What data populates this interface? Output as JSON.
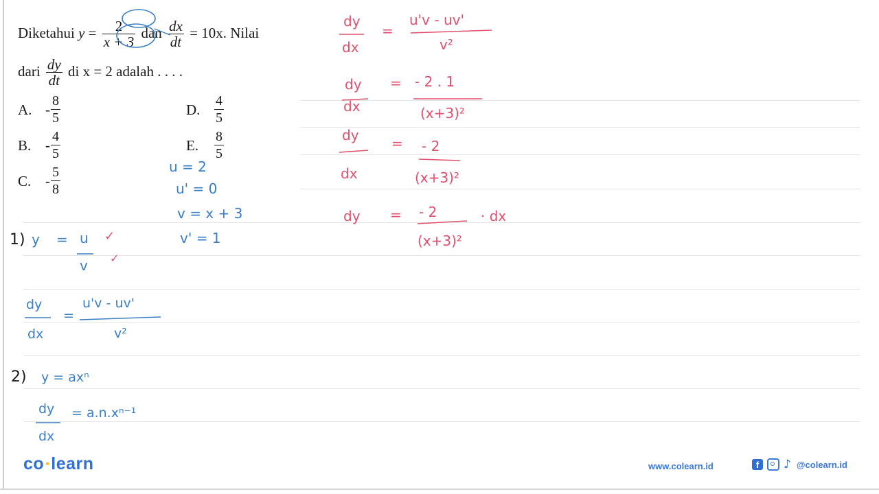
{
  "question": {
    "intro": "Diketahui",
    "y_var": "y",
    "equals": "=",
    "frac1_num": "2",
    "frac1_den": "x + 3",
    "conj": "dan",
    "frac2_num": "dx",
    "frac2_den": "dt",
    "rhs": "= 10x. Nilai",
    "line2_prefix": "dari",
    "frac3_num": "dy",
    "frac3_den": "dt",
    "line2_suffix": "di x = 2 adalah . . . ."
  },
  "options": [
    {
      "letter": "A.",
      "sign": "-",
      "num": "8",
      "den": "5"
    },
    {
      "letter": "B.",
      "sign": "-",
      "num": "4",
      "den": "5"
    },
    {
      "letter": "C.",
      "sign": "-",
      "num": "5",
      "den": "8"
    },
    {
      "letter": "D.",
      "sign": "",
      "num": "4",
      "den": "5"
    },
    {
      "letter": "E.",
      "sign": "",
      "num": "8",
      "den": "5"
    }
  ],
  "handwriting": {
    "blue_defs": [
      "u = 2",
      "u' = 0",
      "v = x + 3",
      "v' = 1"
    ],
    "step1_label": "1)",
    "step1_lhs": "y",
    "step1_eq": "=",
    "step1_num": "u",
    "step1_den": "v",
    "quot_lhs_num": "dy",
    "quot_lhs_den": "dx",
    "quot_eq": "=",
    "quot_rhs_num": "u'v - uv'",
    "quot_rhs_den": "v²",
    "step2_label": "2)",
    "step2_line1": "y = axⁿ",
    "step2_lhs_num": "dy",
    "step2_lhs_den": "dx",
    "step2_rhs": "= a.n.xⁿ⁻¹",
    "red_1_lhs_num": "dy",
    "red_1_lhs_den": "dx",
    "red_1_eq": "=",
    "red_1_num": "u'v - uv'",
    "red_1_den": "v²",
    "red_2_lhs_num": "dy",
    "red_2_lhs_den": "dx",
    "red_2_eq": "=",
    "red_2_num": "- 2 . 1",
    "red_2_den": "(x+3)²",
    "red_3_lhs_num": "dy",
    "red_3_lhs_den": "dx",
    "red_3_eq": "=",
    "red_3_num": "- 2",
    "red_3_den": "(x+3)²",
    "red_4_lhs": "dy",
    "red_4_eq": "=",
    "red_4_num": "- 2",
    "red_4_den": "(x+3)²",
    "red_4_tail": "· dx",
    "check_marks": [
      "✓",
      "✓"
    ]
  },
  "colors": {
    "ink_blue": "#3a7fc4",
    "ink_red": "#e0506e",
    "ink_black": "#1a1a1a",
    "brand_blue": "#2f6fd6",
    "brand_dot": "#f2c230"
  },
  "footer": {
    "brand_left": "co",
    "brand_dot": "•",
    "brand_right": "learn",
    "website": "www.colearn.id",
    "facebook_glyph": "f",
    "tiktok_glyph": "♪",
    "handle": "@colearn.id"
  }
}
